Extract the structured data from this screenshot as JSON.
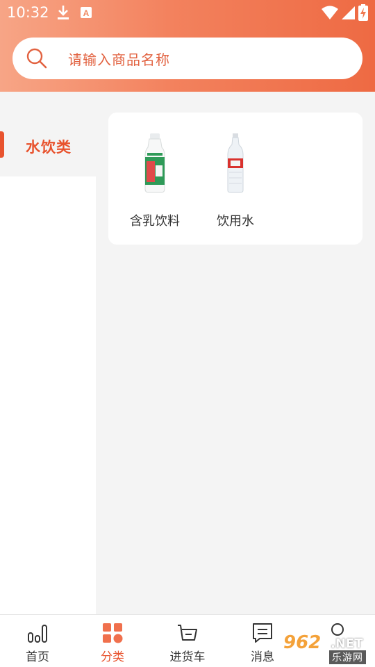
{
  "status_bar": {
    "time": "10:32",
    "icons": [
      "download-icon",
      "a-notification-icon",
      "wifi-icon",
      "signal-icon",
      "battery-charging-icon"
    ]
  },
  "search": {
    "placeholder": "请输入商品名称",
    "icon": "search-icon"
  },
  "sidebar": {
    "items": [
      {
        "label": "水饮类",
        "active": true
      }
    ]
  },
  "products": [
    {
      "name": "含乳饮料",
      "image": "milk-drink-bottle"
    },
    {
      "name": "饮用水",
      "image": "water-bottle"
    }
  ],
  "bottom_nav": {
    "items": [
      {
        "label": "首页",
        "icon": "home-bars-icon",
        "active": false
      },
      {
        "label": "分类",
        "icon": "category-grid-icon",
        "active": true
      },
      {
        "label": "进货车",
        "icon": "cart-icon",
        "active": false
      },
      {
        "label": "消息",
        "icon": "message-icon",
        "active": false
      },
      {
        "label": "",
        "icon": "profile-icon",
        "active": false
      }
    ]
  },
  "watermark": {
    "number": "962",
    "suffix": ".NET",
    "text": "乐游网"
  },
  "colors": {
    "accent": "#e8532e",
    "header_start": "#f7a586",
    "header_end": "#ee6a43",
    "background": "#f4f4f4"
  }
}
